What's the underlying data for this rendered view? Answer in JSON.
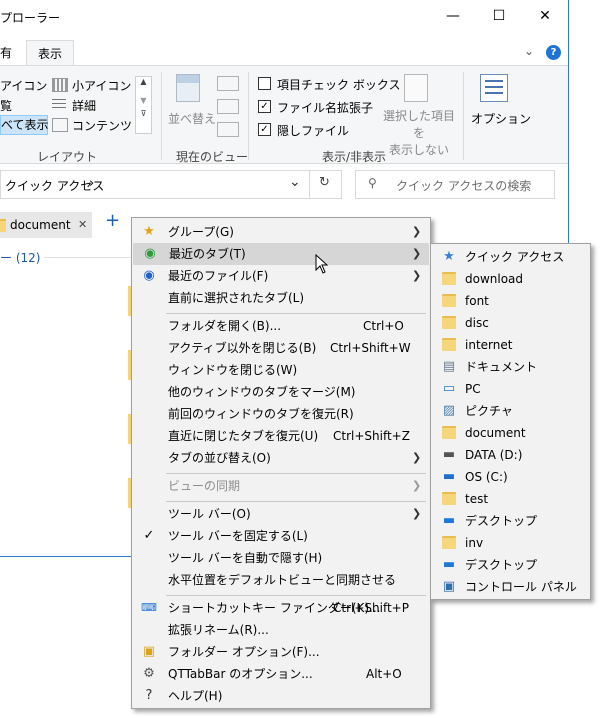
{
  "window": {
    "title_fragment": "プローラー",
    "minimize": "—",
    "maximize": "☐",
    "close": "✕"
  },
  "ribbon_tabs": {
    "home": "有",
    "view": "表示",
    "help_icon": "?"
  },
  "ribbon": {
    "layout": {
      "large_icons": "アイコン",
      "small_icons": "小アイコン",
      "list": "覧",
      "details": "詳細",
      "all": "べて表示",
      "content": "コンテンツ",
      "label": "レイアウト"
    },
    "current_view": {
      "sort": "並べ替え",
      "label": "現在のビュー"
    },
    "show_hide": {
      "item_checkbox": "項目チェック ボックス",
      "file_ext": "ファイル名拡張子",
      "hidden": "隠しファイル",
      "hide_selected": "選択した項目を\n表示しない",
      "label": "表示/非表示",
      "item_checkbox_checked": false,
      "file_ext_checked": true,
      "hidden_checked": true
    },
    "options": {
      "label": "オプション"
    }
  },
  "address": {
    "path": "クイック アクセス",
    "chevron": "›",
    "dropdown": "⌄",
    "refresh": "↻"
  },
  "search": {
    "placeholder": "クイック アクセスの検索"
  },
  "qt_tabs": {
    "tab_label": "document",
    "close": "✕",
    "add": "+"
  },
  "group_header": "ー (12)",
  "context_menu": {
    "items": [
      {
        "label": "グループ(G)",
        "shortcut": "",
        "submenu": true
      },
      {
        "label": "最近のタブ(T)",
        "shortcut": "",
        "submenu": true
      },
      {
        "label": "最近のファイル(F)",
        "shortcut": "",
        "submenu": true
      },
      {
        "label": "直前に選択されたタブ(L)",
        "shortcut": ""
      },
      {
        "label": "フォルダを開く(B)...",
        "shortcut": "Ctrl+O"
      },
      {
        "label": "アクティブ以外を閉じる(B)",
        "shortcut": "Ctrl+Shift+W"
      },
      {
        "label": "ウィンドウを閉じる(W)",
        "shortcut": ""
      },
      {
        "label": "他のウィンドウのタブをマージ(M)",
        "shortcut": ""
      },
      {
        "label": "前回のウィンドウのタブを復元(R)",
        "shortcut": ""
      },
      {
        "label": "直近に閉じたタブを復元(U)",
        "shortcut": "Ctrl+Shift+Z"
      },
      {
        "label": "タブの並び替え(O)",
        "shortcut": "",
        "submenu": true
      },
      {
        "label": "ビューの同期",
        "shortcut": "",
        "submenu": true,
        "disabled": true
      },
      {
        "label": "ツール バー(O)",
        "shortcut": "",
        "submenu": true
      },
      {
        "label": "ツール バーを固定する(L)",
        "shortcut": "",
        "checked": true
      },
      {
        "label": "ツール バーを自動で隠す(H)",
        "shortcut": ""
      },
      {
        "label": "水平位置をデフォルトビューと同期させる",
        "shortcut": ""
      },
      {
        "label": "ショートカットキー ファインダー(K)...",
        "shortcut": "Ctrl+Shift+P"
      },
      {
        "label": "拡張リネーム(R)...",
        "shortcut": ""
      },
      {
        "label": "フォルダー オプション(F)...",
        "shortcut": ""
      },
      {
        "label": "QTTabBar のオプション...",
        "shortcut": "Alt+O"
      },
      {
        "label": "ヘルプ(H)",
        "shortcut": ""
      }
    ],
    "check_mark": "✓",
    "arrow": "❯"
  },
  "recent_tabs_submenu": {
    "items": [
      {
        "label": "クイック アクセス",
        "icon": "quick-access-star-icon"
      },
      {
        "label": "download",
        "icon": "folder-icon"
      },
      {
        "label": "font",
        "icon": "folder-icon"
      },
      {
        "label": "disc",
        "icon": "folder-icon"
      },
      {
        "label": "internet",
        "icon": "folder-icon"
      },
      {
        "label": "ドキュメント",
        "icon": "documents-icon"
      },
      {
        "label": "PC",
        "icon": "pc-icon"
      },
      {
        "label": "ピクチャ",
        "icon": "pictures-icon"
      },
      {
        "label": "document",
        "icon": "folder-icon"
      },
      {
        "label": "DATA (D:)",
        "icon": "drive-icon"
      },
      {
        "label": "OS (C:)",
        "icon": "os-drive-icon"
      },
      {
        "label": "test",
        "icon": "folder-icon"
      },
      {
        "label": "デスクトップ",
        "icon": "desktop-icon"
      },
      {
        "label": "inv",
        "icon": "folder-icon"
      },
      {
        "label": "デスクトップ",
        "icon": "desktop-icon"
      },
      {
        "label": "コントロール パネル",
        "icon": "control-panel-icon"
      }
    ]
  },
  "colors": {
    "accent": "#2b7ad0",
    "menu_bg": "#f2f2f2",
    "highlight": "#d6d6d6",
    "folder": "#f6d67a"
  }
}
